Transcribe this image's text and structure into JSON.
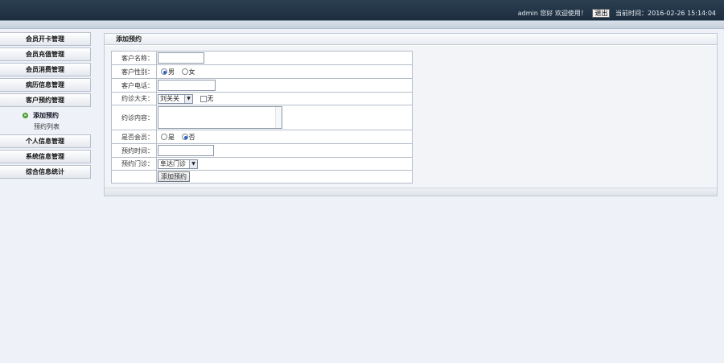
{
  "header": {
    "user": "admin",
    "welcome": "您好 欢迎使用！",
    "logout_label": "退出",
    "time_label": "当前时间：",
    "time_value": "2016-02-26 15:14:04"
  },
  "sidebar": {
    "items": [
      {
        "label": "会员开卡管理"
      },
      {
        "label": "会员充值管理"
      },
      {
        "label": "会员消费管理"
      },
      {
        "label": "病历信息管理"
      },
      {
        "label": "客户预约管理"
      }
    ],
    "submenu": [
      {
        "label": "添加预约",
        "active": true
      },
      {
        "label": "预约列表",
        "active": false
      }
    ],
    "items_after": [
      {
        "label": "个人信息管理"
      },
      {
        "label": "系统信息管理"
      },
      {
        "label": "综合信息统计"
      }
    ]
  },
  "panel": {
    "title": "添加预约"
  },
  "form": {
    "name_label": "客户名称：",
    "name_value": "",
    "gender_label": "客户性别：",
    "gender_options": [
      "男",
      "女"
    ],
    "gender_selected": "男",
    "phone_label": "客户电话：",
    "phone_value": "",
    "doctor_label": "约诊大夫：",
    "doctor_selected": "刘关关",
    "doctor_none_label": "无",
    "content_label": "约诊内容：",
    "content_value": "",
    "member_label": "是否会员：",
    "member_options": [
      "是",
      "否"
    ],
    "member_selected": "否",
    "time_label": "预约时间：",
    "time_value": "",
    "clinic_label": "预约门诊：",
    "clinic_selected": "阜达门诊",
    "submit_label": "添加预约"
  }
}
